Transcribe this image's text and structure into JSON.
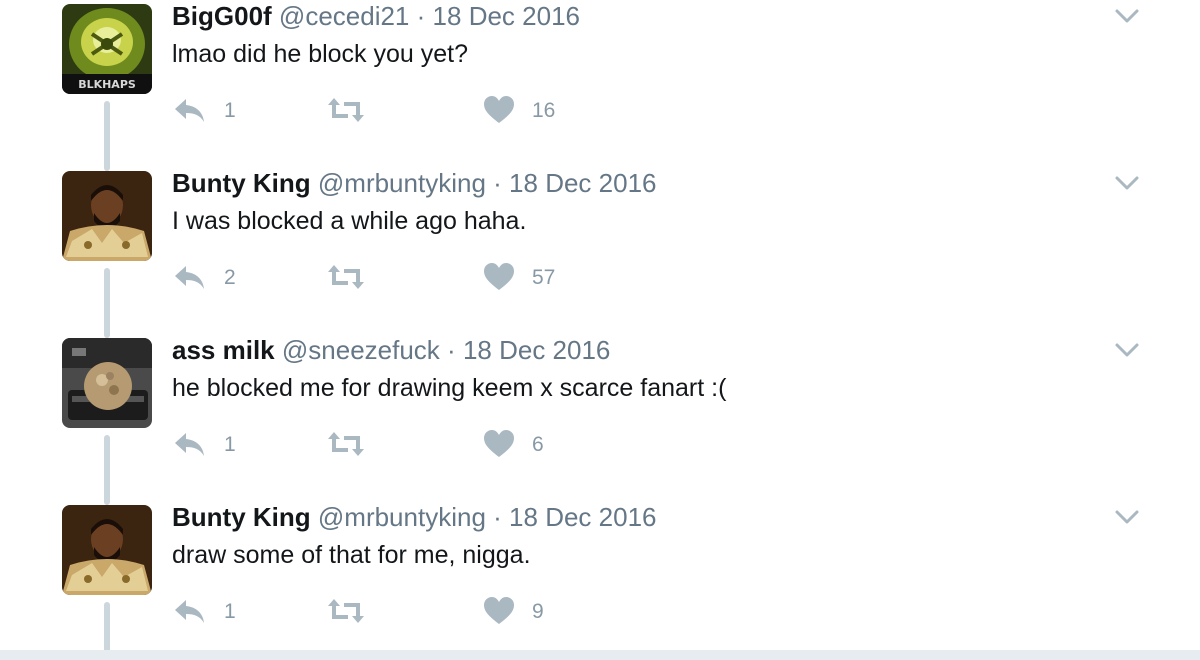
{
  "thread": {
    "tweets": [
      {
        "name": "BigG00f",
        "handle": "@cecedi21",
        "separator": "·",
        "date": "18 Dec 2016",
        "text": "lmao did he block you yet?",
        "replies": "1",
        "retweets": "",
        "likes": "16",
        "avatar_text": "BLKHAPS"
      },
      {
        "name": "Bunty King",
        "handle": "@mrbuntyking",
        "separator": "·",
        "date": "18 Dec 2016",
        "text": "I was blocked a while ago haha.",
        "replies": "2",
        "retweets": "",
        "likes": "57"
      },
      {
        "name": "ass milk",
        "handle": "@sneezefuck",
        "separator": "·",
        "date": "18 Dec 2016",
        "text": "he blocked me for drawing keem x scarce fanart :(",
        "replies": "1",
        "retweets": "",
        "likes": "6"
      },
      {
        "name": "Bunty King",
        "handle": "@mrbuntyking",
        "separator": "·",
        "date": "18 Dec 2016",
        "text": "draw some of that for me, nigga.",
        "replies": "1",
        "retweets": "",
        "likes": "9"
      }
    ]
  },
  "icons": {
    "reply": "reply-icon",
    "retweet": "retweet-icon",
    "like": "heart-icon",
    "more": "chevron-down-icon"
  },
  "colors": {
    "name": "#14171a",
    "secondary_text": "#657786",
    "action_icon": "#aab8c2",
    "action_count": "#8899a6",
    "connector": "#ccd6dd",
    "background": "#ffffff"
  }
}
